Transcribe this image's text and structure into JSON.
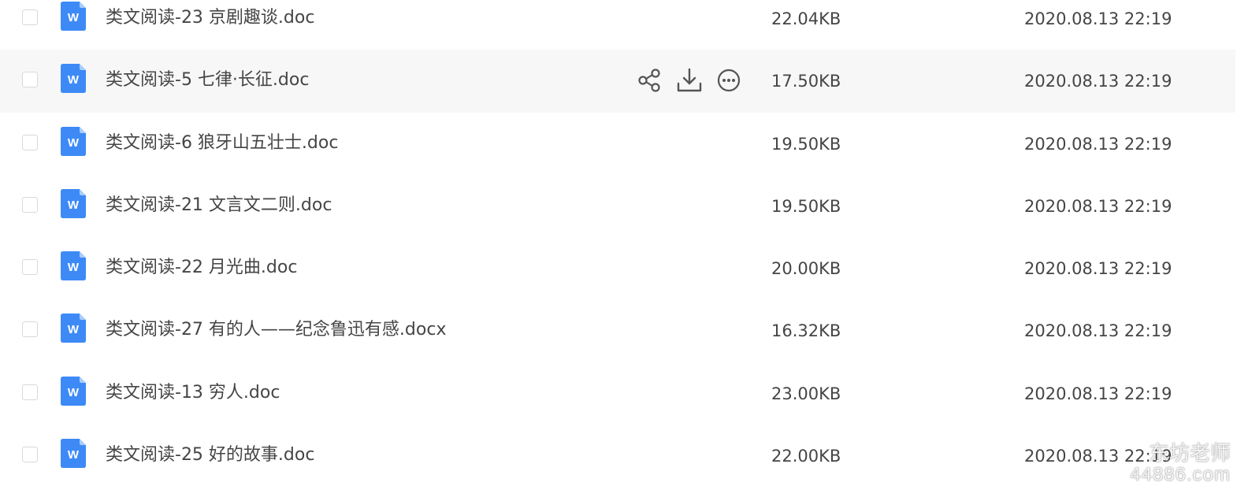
{
  "files": [
    {
      "name": "类文阅读-23 京剧趣谈.doc",
      "size": "22.04KB",
      "date": "2020.08.13 22:19",
      "type_icon": "word-doc-icon",
      "type_letter": "W"
    },
    {
      "name": "类文阅读-5 七律·长征.doc",
      "size": "17.50KB",
      "date": "2020.08.13 22:19",
      "type_icon": "word-doc-icon",
      "type_letter": "W",
      "hovered": true
    },
    {
      "name": "类文阅读-6 狼牙山五壮士.doc",
      "size": "19.50KB",
      "date": "2020.08.13 22:19",
      "type_icon": "word-doc-icon",
      "type_letter": "W"
    },
    {
      "name": "类文阅读-21 文言文二则.doc",
      "size": "19.50KB",
      "date": "2020.08.13 22:19",
      "type_icon": "word-doc-icon",
      "type_letter": "W"
    },
    {
      "name": "类文阅读-22 月光曲.doc",
      "size": "20.00KB",
      "date": "2020.08.13 22:19",
      "type_icon": "word-doc-icon",
      "type_letter": "W"
    },
    {
      "name": "类文阅读-27 有的人——纪念鲁迅有感.docx",
      "size": "16.32KB",
      "date": "2020.08.13 22:19",
      "type_icon": "word-doc-icon",
      "type_letter": "W"
    },
    {
      "name": "类文阅读-13 穷人.doc",
      "size": "23.00KB",
      "date": "2020.08.13 22:19",
      "type_icon": "word-doc-icon",
      "type_letter": "W"
    },
    {
      "name": "类文阅读-25 好的故事.doc",
      "size": "22.00KB",
      "date": "2020.08.13 22:19",
      "type_icon": "word-doc-icon",
      "type_letter": "W"
    }
  ],
  "row_actions": [
    {
      "icon": "share-icon"
    },
    {
      "icon": "download-icon"
    },
    {
      "icon": "more-options-icon"
    }
  ],
  "watermark": {
    "line1": "东坊老师",
    "line2": "44886.com"
  },
  "colors": {
    "word_blue": "#3d8af7",
    "word_blue_fold": "#a9cdfb",
    "hover_row_bg": "#f7f7f7",
    "text": "#454545",
    "icon_gray": "#555555",
    "checkbox_border": "#d9d9d9"
  }
}
